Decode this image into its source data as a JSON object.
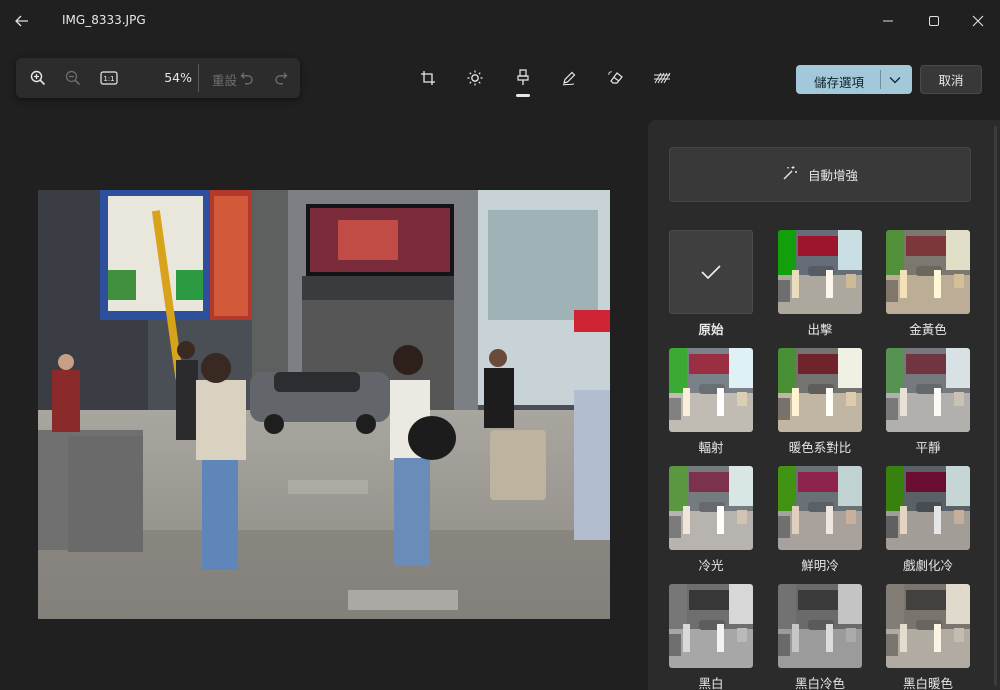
{
  "titlebar": {
    "title": "IMG_8333.JPG"
  },
  "zoombar": {
    "zoom_percent": "54%",
    "reset_label": "重設",
    "actual_size_label": "1:1"
  },
  "actions": {
    "save_label": "儲存選項",
    "cancel_label": "取消"
  },
  "panel": {
    "auto_enhance_label": "自動增強",
    "filters": [
      {
        "label": "原始",
        "selected": true,
        "tone": "original"
      },
      {
        "label": "出擊",
        "tone": "punch"
      },
      {
        "label": "金黃色",
        "tone": "golden"
      },
      {
        "label": "輻射",
        "tone": "radiate"
      },
      {
        "label": "暖色系對比",
        "tone": "warm-contrast"
      },
      {
        "label": "平靜",
        "tone": "calm"
      },
      {
        "label": "冷光",
        "tone": "cool-light"
      },
      {
        "label": "鮮明冷",
        "tone": "vivid-cool"
      },
      {
        "label": "戲劇化冷",
        "tone": "dramatic-cool"
      },
      {
        "label": "黑白",
        "tone": "bw"
      },
      {
        "label": "黑白冷色",
        "tone": "bw-cool"
      },
      {
        "label": "黑白暖色",
        "tone": "bw-warm"
      }
    ]
  },
  "colors": {
    "accent": "#a3c8d9",
    "background": "#202020",
    "panel": "#2b2b2b"
  }
}
